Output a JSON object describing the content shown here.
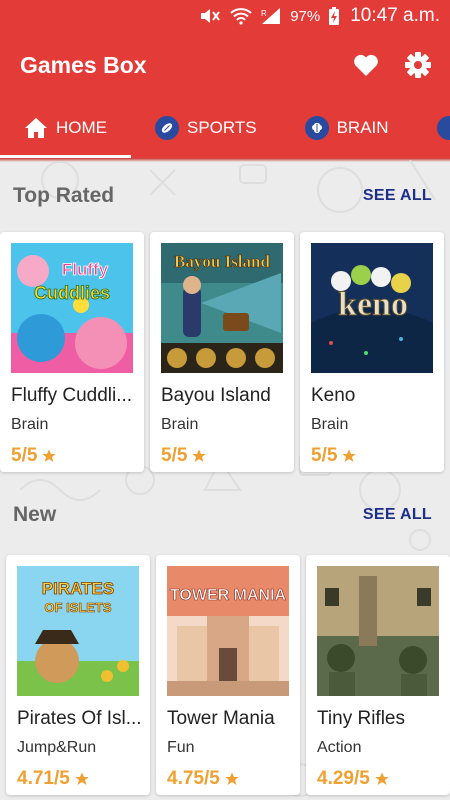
{
  "status": {
    "battery": "97%",
    "time": "10:47 a.m."
  },
  "app": {
    "title": "Games Box"
  },
  "tabs": [
    {
      "label": "HOME",
      "icon": "home-icon"
    },
    {
      "label": "SPORTS",
      "icon": "sports-icon"
    },
    {
      "label": "BRAIN",
      "icon": "brain-icon"
    }
  ],
  "sections": {
    "top_rated": {
      "title": "Top Rated",
      "see_all": "SEE ALL",
      "games": [
        {
          "name": "Fluffy Cuddlies",
          "display_name": "Fluffy Cuddli...",
          "category": "Brain",
          "rating": "5/5",
          "thumb_text": "Fluffy Cuddlies"
        },
        {
          "name": "Bayou Island",
          "display_name": "Bayou Island",
          "category": "Brain",
          "rating": "5/5",
          "thumb_text": "Bayou Island"
        },
        {
          "name": "Keno",
          "display_name": "Keno",
          "category": "Brain",
          "rating": "5/5",
          "thumb_text": "keno"
        }
      ]
    },
    "new": {
      "title": "New",
      "see_all": "SEE ALL",
      "games": [
        {
          "name": "Pirates Of Islets",
          "display_name": "Pirates Of Isl...",
          "category": "Jump&Run",
          "rating": "4.71/5",
          "thumb_text": "PIRATES OF ISLETS"
        },
        {
          "name": "Tower Mania",
          "display_name": "Tower Mania",
          "category": "Fun",
          "rating": "4.75/5",
          "thumb_text": "TOWER MANIA"
        },
        {
          "name": "Tiny Rifles",
          "display_name": "Tiny Rifles",
          "category": "Action",
          "rating": "4.29/5",
          "thumb_text": ""
        }
      ]
    }
  },
  "colors": {
    "primary": "#e33b38",
    "accent_link": "#1e2f8a",
    "rating": "#f0a030"
  }
}
